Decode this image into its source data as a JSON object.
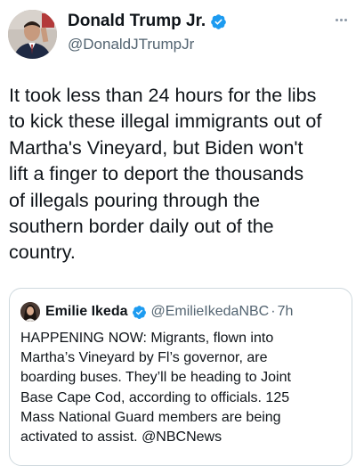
{
  "author": {
    "display_name": "Donald Trump Jr.",
    "handle": "@DonaldJTrumpJr",
    "verified_icon": "verified-badge-icon",
    "avatar_icon": "profile-avatar"
  },
  "menu": {
    "icon": "more-options-icon"
  },
  "tweet": {
    "text": "It took less than 24 hours for the libs\nto kick these illegal immigrants out of\nMartha's Vineyard, but Biden won't\nlift a finger to deport the thousands\nof illegals pouring through the\nsouthern border daily out of the\ncountry."
  },
  "quoted_tweet": {
    "display_name": "Emilie Ikeda",
    "handle": "@EmilieIkedaNBC",
    "separator": "·",
    "time": "7h",
    "text": "HAPPENING NOW: Migrants, flown into\nMartha’s Vineyard by Fl’s governor, are\nboarding buses. They’ll be heading to Joint\nBase Cape Cod, according to officials. 125\nMass National Guard members are being\nactivated to assist. @NBCNews"
  },
  "colors": {
    "verified_blue": "#1d9bf0",
    "primary_text": "#0f1419",
    "secondary_text": "#536471",
    "border": "#cfd9de"
  }
}
